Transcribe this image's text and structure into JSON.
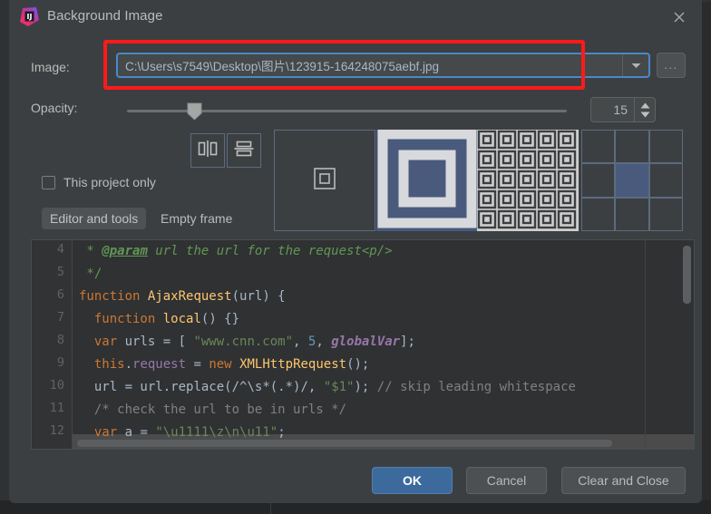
{
  "window": {
    "title": "Background Image",
    "app_icon": "intellij-idea-logo",
    "close_icon": "close-icon"
  },
  "colors": {
    "dialog_bg": "#3c3f41",
    "accent_blue": "#4a88c7",
    "primary_button": "#3c6a9c",
    "highlight_red": "#ff1a1a",
    "text": "#bbbbbb",
    "editor_bg": "#2f3133"
  },
  "image_row": {
    "label": "Image:",
    "path_value": "C:\\Users\\s7549\\Desktop\\图片\\123915-164248075aebf.jpg",
    "path_placeholder": "",
    "dropdown_icon": "chevron-down-icon",
    "browse_label": "...",
    "highlighted": true
  },
  "opacity_row": {
    "label": "Opacity:",
    "value": "15",
    "min": 0,
    "max": 100,
    "slider_percent": 15,
    "stepper_up_icon": "triangle-up-icon",
    "stepper_down_icon": "triangle-down-icon"
  },
  "flip_buttons": [
    {
      "name": "flip-horizontal",
      "icon": "flip-horizontal-icon"
    },
    {
      "name": "flip-vertical",
      "icon": "flip-vertical-icon"
    }
  ],
  "project_only": {
    "label": "This project only",
    "checked": false
  },
  "tabs": [
    {
      "label": "Editor and tools",
      "selected": true
    },
    {
      "label": "Empty frame",
      "selected": false
    }
  ],
  "fill_modes": [
    {
      "name": "center",
      "icon": "center-image-icon",
      "selected": false
    },
    {
      "name": "scale",
      "icon": "scale-image-icon",
      "selected": false
    },
    {
      "name": "tile",
      "icon": "tile-image-icon",
      "selected": false
    }
  ],
  "anchor_grid": {
    "name": "anchor-position-grid",
    "selected_index": 4,
    "cells": 9
  },
  "code_preview": {
    "line_numbers": [
      "4",
      "5",
      "6",
      "7",
      "8",
      "9",
      "10",
      "11",
      "12"
    ],
    "lines": [
      " * @param url the url for the request<p/>",
      " */",
      "function AjaxRequest(url) {",
      "  function local() {}",
      "  var urls = [ \"www.cnn.com\", 5, globalVar];",
      "  this.request = new XMLHttpRequest();",
      "  url = url.replace(/^\\s*(.*)/, \"$1\"); // skip leading whitespace",
      "  /* check the url to be in urls */",
      "  var a = \"\\u1111\\z\\n\\u11\";"
    ],
    "highlighted_line": "12",
    "vertical_scrollbar": true,
    "horizontal_scrollbar": true
  },
  "buttons": {
    "ok": "OK",
    "cancel": "Cancel",
    "clear_and_close": "Clear and Close"
  }
}
